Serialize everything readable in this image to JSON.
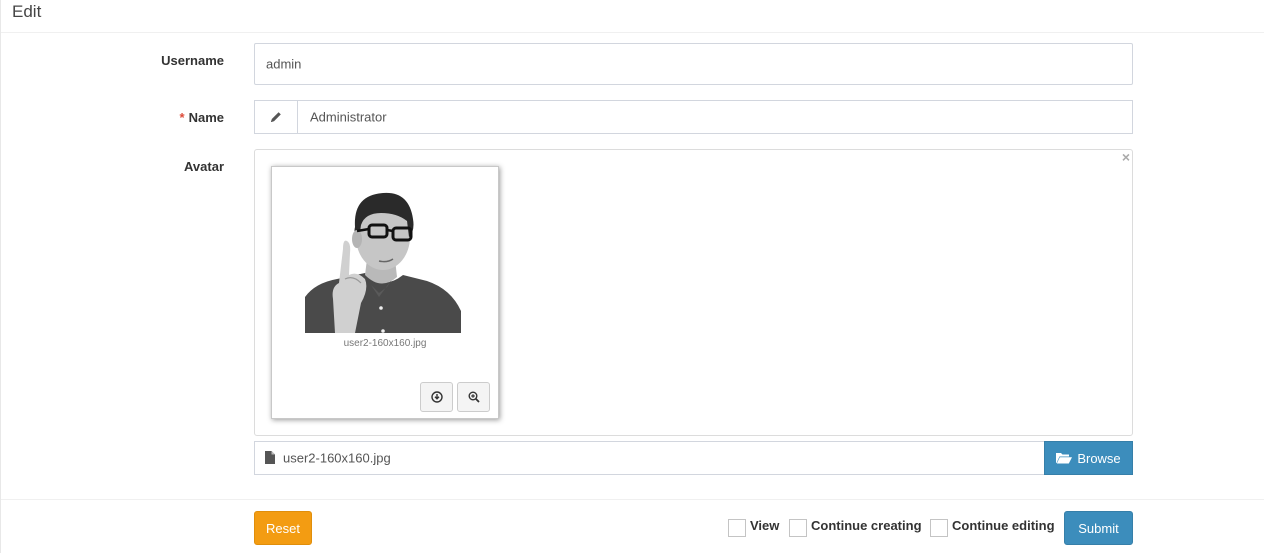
{
  "header": {
    "title": "Edit"
  },
  "form": {
    "username": {
      "label": "Username",
      "value": "admin"
    },
    "name": {
      "required_mark": "*",
      "label": "Name",
      "value": "Administrator",
      "addon_icon": "pencil-icon"
    },
    "avatar": {
      "label": "Avatar",
      "close_symbol": "×",
      "preview_caption": "user2-160x160.jpg",
      "file_name": "user2-160x160.jpg",
      "browse_label": "Browse",
      "download_icon": "download-icon",
      "zoom_icon": "zoom-in-icon"
    }
  },
  "footer": {
    "reset_label": "Reset",
    "submit_label": "Submit",
    "checks": [
      {
        "label": "View",
        "checked": false
      },
      {
        "label": "Continue creating",
        "checked": false
      },
      {
        "label": "Continue editing",
        "checked": false
      }
    ]
  },
  "colors": {
    "primary": "#3c8dbc",
    "warning": "#f39c12",
    "required": "#dd4b39"
  }
}
